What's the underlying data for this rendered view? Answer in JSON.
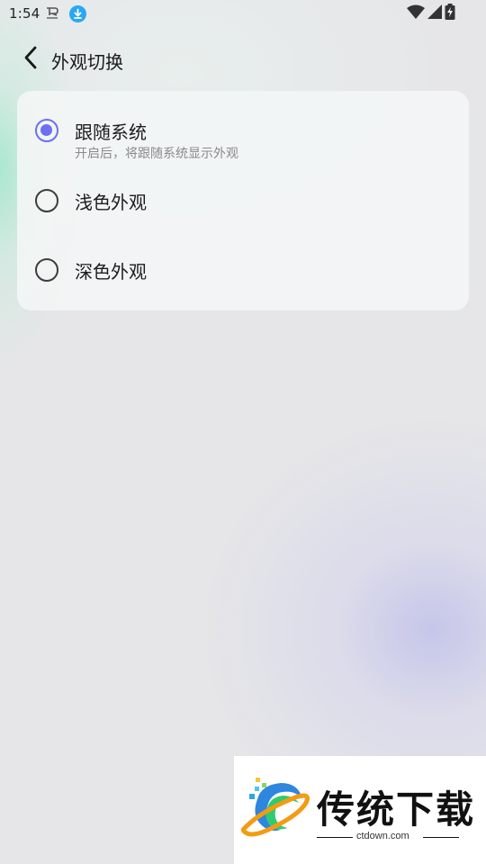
{
  "status_bar": {
    "time": "1:54",
    "icons": [
      "app-r-icon",
      "download-icon",
      "wifi-icon",
      "signal-icon",
      "battery-charging-icon"
    ]
  },
  "header": {
    "title": "外观切换",
    "back_icon": "chevron-left-icon"
  },
  "options": [
    {
      "label": "跟随系统",
      "sub": "开启后，将跟随系统显示外观",
      "selected": true
    },
    {
      "label": "浅色外观",
      "selected": false
    },
    {
      "label": "深色外观",
      "selected": false
    }
  ],
  "colors": {
    "accent": "#6f6ff0",
    "download_badge": "#29a7f5"
  },
  "watermark": {
    "text": "传统下载",
    "url": "ctdown.com"
  }
}
